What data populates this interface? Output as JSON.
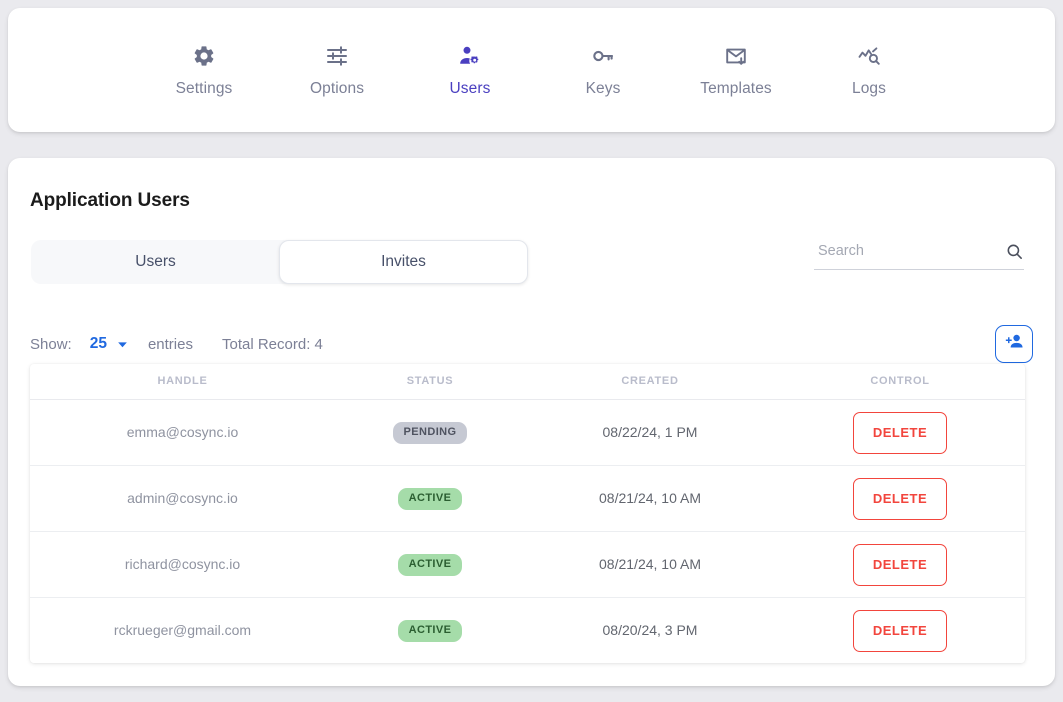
{
  "nav": {
    "items": [
      {
        "label": "Settings",
        "icon": "gear-icon",
        "active": false
      },
      {
        "label": "Options",
        "icon": "sliders-icon",
        "active": false
      },
      {
        "label": "Users",
        "icon": "user-settings-icon",
        "active": true
      },
      {
        "label": "Keys",
        "icon": "key-icon",
        "active": false
      },
      {
        "label": "Templates",
        "icon": "envelope-down-icon",
        "active": false
      },
      {
        "label": "Logs",
        "icon": "chart-search-icon",
        "active": false
      }
    ],
    "active_color": "#4a3fc0",
    "inactive_color": "#7c8096"
  },
  "main": {
    "title": "Application Users",
    "segmented": {
      "options": [
        {
          "label": "Users",
          "selected": false
        },
        {
          "label": "Invites",
          "selected": true
        }
      ]
    },
    "search": {
      "value": "",
      "placeholder": "Search",
      "icon": "search-icon"
    },
    "controls": {
      "show_label": "Show:",
      "show_value": "25",
      "show_chevron": "chevron-down-icon",
      "entries_label": "entries",
      "total_record": "Total Record: 4",
      "add_user_icon": "person-add-icon",
      "accent_color": "#2069e0"
    },
    "table": {
      "columns": [
        "HANDLE",
        "STATUS",
        "CREATED",
        "CONTROL"
      ],
      "delete_label": "DELETE",
      "rows": [
        {
          "handle": "emma@cosync.io",
          "status": "PENDING",
          "status_kind": "pending",
          "created": "08/22/24, 1 PM",
          "control": "DELETE"
        },
        {
          "handle": "admin@cosync.io",
          "status": "ACTIVE",
          "status_kind": "active",
          "created": "08/21/24, 10 AM",
          "control": "DELETE"
        },
        {
          "handle": "richard@cosync.io",
          "status": "ACTIVE",
          "status_kind": "active",
          "created": "08/21/24, 10 AM",
          "control": "DELETE"
        },
        {
          "handle": "rckrueger@gmail.com",
          "status": "ACTIVE",
          "status_kind": "active",
          "created": "08/20/24, 3 PM",
          "control": "DELETE"
        }
      ]
    }
  },
  "colors": {
    "page_background": "#eaeaee",
    "card_background": "#ffffff",
    "danger": "#f2453d",
    "status_pending_bg": "#c6c9d3",
    "status_active_bg": "#a5dca9"
  }
}
